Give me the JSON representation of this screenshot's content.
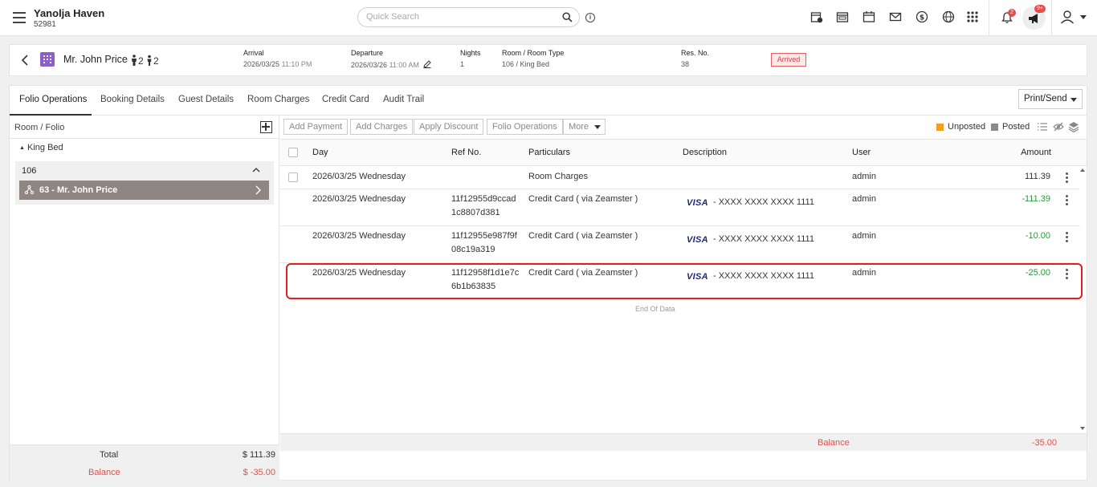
{
  "app": {
    "hotel_name": "Yanolja Haven",
    "hotel_id": "52981",
    "search_placeholder": "Quick Search",
    "notifications_count": "2",
    "announcements_count": "9+"
  },
  "guest": {
    "name": "Mr. John Price",
    "adults": "2",
    "children": "2",
    "arrival_label": "Arrival",
    "arrival_date": "2026/03/25",
    "arrival_time": "11:10 PM",
    "departure_label": "Departure",
    "departure_date": "2026/03/26",
    "departure_time": "11:00 AM",
    "nights_label": "Nights",
    "nights": "1",
    "room_label": "Room / Room Type",
    "room": "106 / King Bed",
    "res_label": "Res. No.",
    "res_no": "38",
    "status": "Arrived"
  },
  "tabs": [
    "Folio Operations",
    "Booking Details",
    "Guest Details",
    "Room Charges",
    "Credit Card",
    "Audit Trail"
  ],
  "print_send_label": "Print/Send",
  "left_panel": {
    "title": "Room / Folio",
    "room_type": "King Bed",
    "room_number": "106",
    "folio_label": "63 - Mr. John Price",
    "total_label": "Total",
    "total_value": "$ 111.39",
    "balance_label": "Balance",
    "balance_value": "$ -35.00"
  },
  "actions": {
    "add_payment": "Add Payment",
    "add_charges": "Add Charges",
    "apply_discount": "Apply Discount",
    "folio_operations": "Folio Operations",
    "more": "More"
  },
  "legend": {
    "unposted": "Unposted",
    "posted": "Posted",
    "unposted_color": "#f0a020",
    "posted_color": "#8a8a8a"
  },
  "table": {
    "headers": {
      "day": "Day",
      "ref": "Ref No.",
      "particulars": "Particulars",
      "description": "Description",
      "user": "User",
      "amount": "Amount"
    },
    "rows": [
      {
        "day": "2026/03/25 Wednesday",
        "ref1": "",
        "ref2": "",
        "particulars": "Room Charges",
        "card_brand": "",
        "card_mask": "",
        "user": "admin",
        "amount": "111.39"
      },
      {
        "day": "2026/03/25 Wednesday",
        "ref1": "11f12955d9ccad",
        "ref2": "1c8807d381",
        "particulars": "Credit Card ( via Zeamster )",
        "card_brand": "VISA",
        "card_mask": "- XXXX XXXX XXXX 1111",
        "user": "admin",
        "amount": "-111.39"
      },
      {
        "day": "2026/03/25 Wednesday",
        "ref1": "11f12955e987f9f",
        "ref2": "08c19a319",
        "particulars": "Credit Card ( via Zeamster )",
        "card_brand": "VISA",
        "card_mask": "- XXXX XXXX XXXX 1111",
        "user": "admin",
        "amount": "-10.00"
      },
      {
        "day": "2026/03/25 Wednesday",
        "ref1": "11f12958f1d1e7c",
        "ref2": "6b1b63835",
        "particulars": "Credit Card ( via Zeamster )",
        "card_brand": "VISA",
        "card_mask": "- XXXX XXXX XXXX 1111",
        "user": "admin",
        "amount": "-25.00"
      }
    ],
    "end_of_data": "End Of Data",
    "balance_label": "Balance",
    "balance_value": "-35.00"
  }
}
